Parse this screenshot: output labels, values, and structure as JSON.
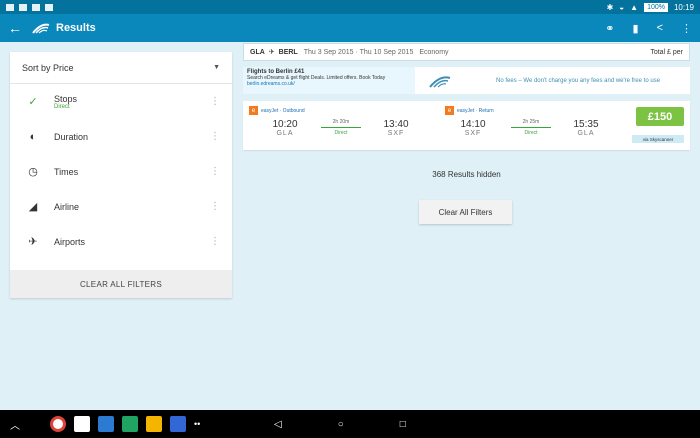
{
  "status": {
    "battery": "100%",
    "time": "10:19"
  },
  "appbar": {
    "title": "Results"
  },
  "sidebar": {
    "sort_label": "Sort by Price",
    "filters": [
      {
        "label": "Stops",
        "sub": "Direct"
      },
      {
        "label": "Duration",
        "sub": ""
      },
      {
        "label": "Times",
        "sub": ""
      },
      {
        "label": "Airline",
        "sub": ""
      },
      {
        "label": "Airports",
        "sub": ""
      }
    ],
    "clear_label": "CLEAR ALL FILTERS"
  },
  "search": {
    "origin": "GLA",
    "destination": "BERL",
    "dates": "Thu 3 Sep 2015 · Thu 10 Sep 2015",
    "cabin": "Economy",
    "total_label": "Total £ per"
  },
  "ad": {
    "title": "Flights to Berlin £41",
    "body": "Search eDreams & get flight Deals. Limited offers. Book Today",
    "link": "berlin.edreams.co.uk/",
    "message": "No fees – We don't charge you any fees and we're free to use"
  },
  "result": {
    "outbound": {
      "carrier": "easyJet · Outbound",
      "dep_time": "10:20",
      "dep_code": "GLA",
      "duration": "2h 20m",
      "stops": "Direct",
      "arr_time": "13:40",
      "arr_code": "SXF"
    },
    "inbound": {
      "carrier": "easyJet · Return",
      "dep_time": "14:10",
      "dep_code": "SXF",
      "duration": "2h 25m",
      "stops": "Direct",
      "arr_time": "15:35",
      "arr_code": "GLA"
    },
    "price": "£150",
    "via": "via Skyscanner"
  },
  "hidden_count": "368 Results hidden",
  "clear_button": "Clear All Filters",
  "colors": {
    "status": "#03739d",
    "appbar": "#0a87bb",
    "price": "#7cc243",
    "background": "#dff0f7"
  }
}
